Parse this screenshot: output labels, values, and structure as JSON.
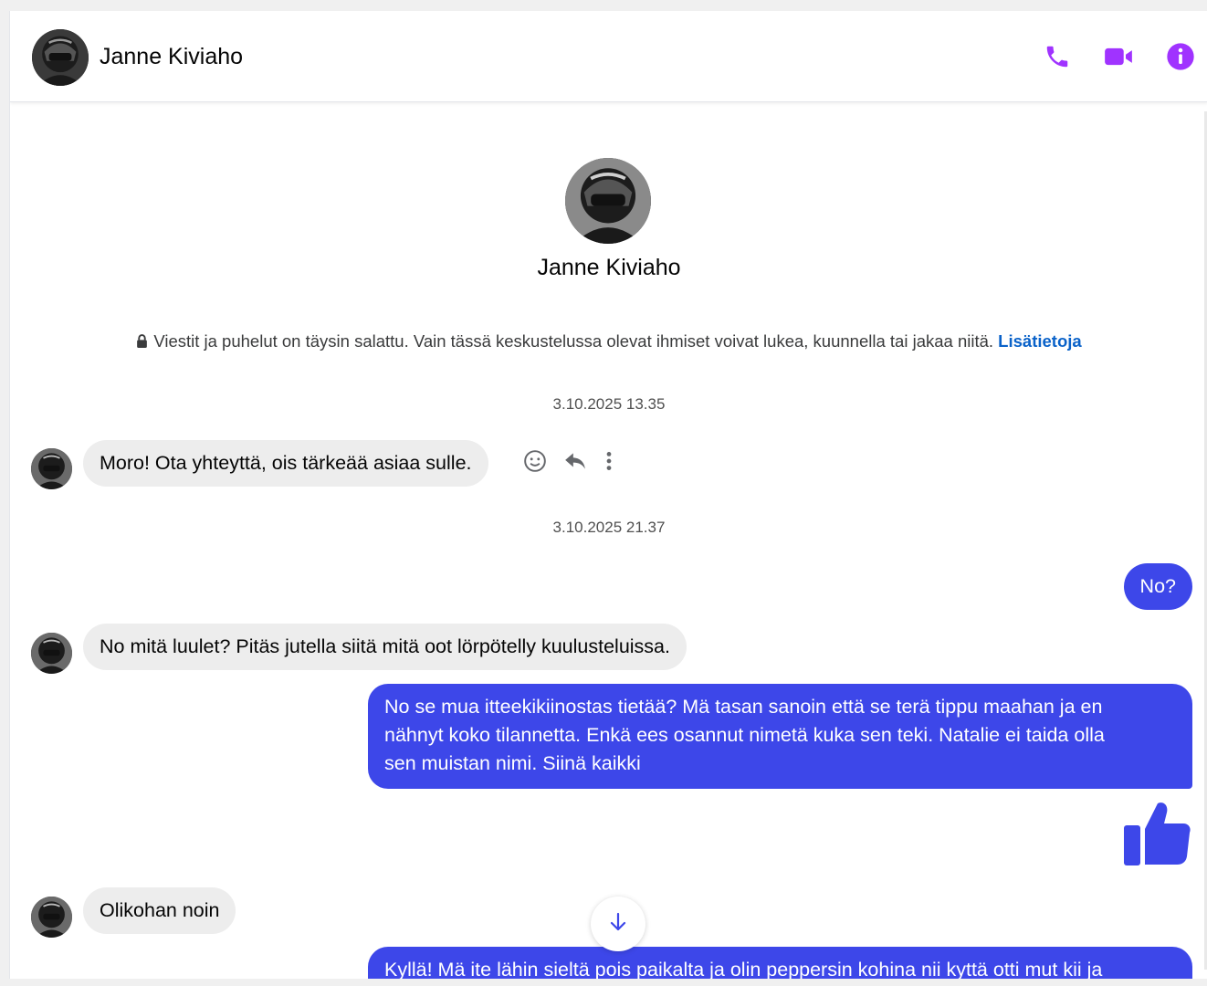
{
  "header": {
    "contact_name": "Janne Kiviaho",
    "icons": [
      "phone-icon",
      "video-camera-icon",
      "info-icon"
    ],
    "accent_color": "#a033ff"
  },
  "profile": {
    "name": "Janne Kiviaho"
  },
  "encryption_notice": {
    "text": "Viestit ja puhelut on täysin salattu. Vain tässä keskustelussa olevat ihmiset voivat lukea, kuunnella tai jakaa niitä.",
    "link": "Lisätietoja",
    "link_color": "#0a62c9"
  },
  "timestamps": [
    "3.10.2025 13.35",
    "3.10.2025 21.37"
  ],
  "messages": [
    {
      "direction": "incoming",
      "text": "Moro! Ota yhteyttä, ois tärkeää asiaa sulle."
    },
    {
      "direction": "outgoing",
      "text": "No?"
    },
    {
      "direction": "incoming",
      "text": "No mitä luulet? Pitäs jutella siitä mitä oot lörpötelly kuulusteluissa."
    },
    {
      "direction": "outgoing",
      "lines": [
        "No se mua itteekikiinostas tietää? Mä tasan sanoin että se terä tippu maahan ja en",
        "nähnyt koko tilannetta. Enkä ees osannut nimetä kuka sen teki. Natalie ei taida olla",
        "sen muistan nimi. Siinä kaikki"
      ]
    },
    {
      "direction": "outgoing",
      "sticker": "thumbs-up-icon"
    },
    {
      "direction": "incoming",
      "text": "Olikohan noin"
    },
    {
      "direction": "outgoing",
      "text": "Kyllä! Mä ite lähin sieltä pois paikalta ja olin peppersin kohina nii kyttä otti mut kii ja"
    }
  ],
  "message_actions": [
    "smiley-react-icon",
    "reply-icon",
    "more-options-icon"
  ],
  "colors": {
    "outgoing_bubble": "#3d47e9",
    "incoming_bubble": "#ededed"
  }
}
